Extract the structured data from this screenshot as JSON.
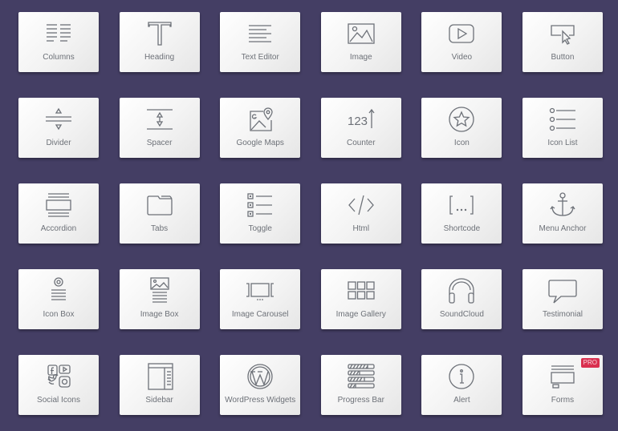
{
  "widgets": [
    {
      "label": "Columns",
      "icon": "columns-icon"
    },
    {
      "label": "Heading",
      "icon": "heading-icon"
    },
    {
      "label": "Text Editor",
      "icon": "text-editor-icon"
    },
    {
      "label": "Image",
      "icon": "image-icon"
    },
    {
      "label": "Video",
      "icon": "video-icon"
    },
    {
      "label": "Button",
      "icon": "button-icon"
    },
    {
      "label": "Divider",
      "icon": "divider-icon"
    },
    {
      "label": "Spacer",
      "icon": "spacer-icon"
    },
    {
      "label": "Google Maps",
      "icon": "google-maps-icon"
    },
    {
      "label": "Counter",
      "icon": "counter-icon",
      "icon_text": "123"
    },
    {
      "label": "Icon",
      "icon": "star-icon"
    },
    {
      "label": "Icon List",
      "icon": "icon-list-icon"
    },
    {
      "label": "Accordion",
      "icon": "accordion-icon"
    },
    {
      "label": "Tabs",
      "icon": "tabs-icon"
    },
    {
      "label": "Toggle",
      "icon": "toggle-icon"
    },
    {
      "label": "Html",
      "icon": "html-icon"
    },
    {
      "label": "Shortcode",
      "icon": "shortcode-icon",
      "icon_text": "[...]"
    },
    {
      "label": "Menu Anchor",
      "icon": "anchor-icon"
    },
    {
      "label": "Icon Box",
      "icon": "icon-box-icon"
    },
    {
      "label": "Image Box",
      "icon": "image-box-icon"
    },
    {
      "label": "Image Carousel",
      "icon": "image-carousel-icon"
    },
    {
      "label": "Image Gallery",
      "icon": "image-gallery-icon"
    },
    {
      "label": "SoundCloud",
      "icon": "headphones-icon"
    },
    {
      "label": "Testimonial",
      "icon": "speech-bubble-icon"
    },
    {
      "label": "Social Icons",
      "icon": "social-icons-icon"
    },
    {
      "label": "Sidebar",
      "icon": "sidebar-icon"
    },
    {
      "label": "WordPress Widgets",
      "icon": "wordpress-icon"
    },
    {
      "label": "Progress Bar",
      "icon": "progress-bar-icon"
    },
    {
      "label": "Alert",
      "icon": "info-icon"
    },
    {
      "label": "Forms",
      "icon": "forms-icon",
      "badge": "PRO"
    }
  ],
  "colors": {
    "background": "#443e64",
    "card": "#f5f5f5",
    "icon": "#6d7178",
    "pro_badge": "#d9304f"
  }
}
